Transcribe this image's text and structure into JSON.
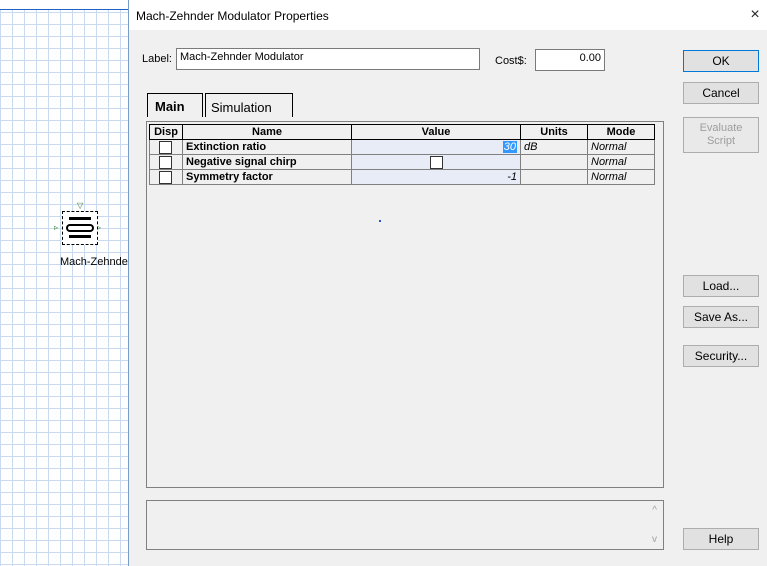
{
  "dialog": {
    "title": "Mach-Zehnder Modulator Properties",
    "close_glyph": "×",
    "label_caption": "Label:",
    "label_value": "Mach-Zehnder Modulator",
    "cost_caption": "Cost$:",
    "cost_value": "0.00"
  },
  "buttons": {
    "ok": "OK",
    "cancel": "Cancel",
    "evaluate_line1": "Evaluate",
    "evaluate_line2": "Script",
    "load": "Load...",
    "save_as": "Save As...",
    "security": "Security...",
    "help": "Help"
  },
  "tabs": [
    {
      "label": "Main",
      "active": true
    },
    {
      "label": "Simulation",
      "active": false
    }
  ],
  "grid": {
    "columns": [
      "Disp",
      "Name",
      "Value",
      "Units",
      "Mode"
    ],
    "rows": [
      {
        "name": "Extinction ratio",
        "value": "30",
        "units": "dB",
        "mode": "Normal",
        "value_selected": true
      },
      {
        "name": "Negative signal chirp",
        "value": "",
        "value_checkbox": true,
        "units": "",
        "mode": "Normal"
      },
      {
        "name": "Symmetry factor",
        "value": "-1",
        "units": "",
        "mode": "Normal"
      }
    ]
  },
  "canvas": {
    "component_label": "Mach-Zehnde"
  },
  "scroll": {
    "up": "^",
    "down": "v"
  },
  "icons": [
    "close-icon",
    "checkbox-icon",
    "mach-zehnder-modulator-icon",
    "scroll-up-icon",
    "scroll-down-icon"
  ]
}
